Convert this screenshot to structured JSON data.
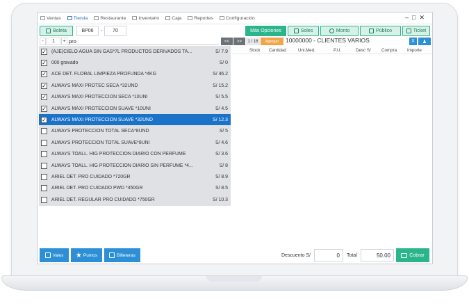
{
  "menu": {
    "items": [
      {
        "label": "Ventas",
        "icon": "chart-icon",
        "active": false
      },
      {
        "label": "Tienda",
        "icon": "store-icon",
        "active": true
      },
      {
        "label": "Restaurante",
        "icon": "cutlery-icon",
        "active": false
      },
      {
        "label": "Inventario",
        "icon": "inventory-icon",
        "active": false
      },
      {
        "label": "Caja",
        "icon": "cash-icon",
        "active": false
      },
      {
        "label": "Reportes",
        "icon": "report-icon",
        "active": false
      },
      {
        "label": "Configuración",
        "icon": "gear-icon",
        "active": false
      }
    ],
    "window_controls": "–□✕"
  },
  "toolbar": {
    "boleta": "Boleta",
    "series": "BP06",
    "dash": "-",
    "number": "70",
    "mas_opciones": "Más Opciones",
    "soles": "Soles",
    "monto": "Monto",
    "publico": "Público",
    "ticket": "Ticket"
  },
  "nav": {
    "minus": "-",
    "page": "1",
    "plus": "+",
    "search_value": "pro",
    "prev": "<<",
    "next": ">>",
    "page_count": "1 / 16",
    "agregar": "Agregar",
    "client": "10000000 - CLIENTES VARIOS",
    "clear": "X"
  },
  "products": [
    {
      "name": "(AJE)CIELO AGUA SIN GAS*7L PRODUCTOS DERIVADOS TA...",
      "price": "S/ 7.9",
      "checked": true,
      "selected": false
    },
    {
      "name": "000 gravado",
      "price": "S/ 0",
      "checked": true,
      "selected": false
    },
    {
      "name": "ACE DET. FLORAL LIMPIEZA PROFUNDA *4KG",
      "price": "S/ 46.2",
      "checked": true,
      "selected": false
    },
    {
      "name": "ALWAYS MAXI PROTEC SECA *32UND",
      "price": "S/ 15.2",
      "checked": true,
      "selected": false
    },
    {
      "name": "ALWAYS MAXI PROTECCION SECA *10UNI",
      "price": "S/ 5.5",
      "checked": true,
      "selected": false
    },
    {
      "name": "ALWAYS MAXI PROTECCION SUAVE *10UNI",
      "price": "S/ 4.5",
      "checked": true,
      "selected": false
    },
    {
      "name": "ALWAYS MAXI PROTECCION SUAVE *32UND",
      "price": "S/ 12.3",
      "checked": true,
      "selected": true
    },
    {
      "name": "ALWAYS PROTECCION TOTAL SECA*8UND",
      "price": "S/ 5",
      "checked": false,
      "selected": false
    },
    {
      "name": "ALWAYS PROTECCION TOTAL SUAVE*8UNI",
      "price": "S/ 4.6",
      "checked": false,
      "selected": false
    },
    {
      "name": "ALWAYS TOALL. HIG PROTECCION DIARIO CON PERFUME",
      "price": "S/ 3.6",
      "checked": false,
      "selected": false
    },
    {
      "name": "ALWAYS TOALL. HIG PROTECCION DIARIO SIN PERFUME *4...",
      "price": "S/ 8",
      "checked": false,
      "selected": false
    },
    {
      "name": "ARIEL DET. PRO CUIDADO *720GR",
      "price": "S/ 8.9",
      "checked": false,
      "selected": false
    },
    {
      "name": "ARIEL DET. PRO CUIDADO PWD *450GR",
      "price": "S/ 8.5",
      "checked": false,
      "selected": false
    },
    {
      "name": "ARIEL DET. REGULAR PRO CUIDADO *750GR",
      "price": "S/ 10.3",
      "checked": false,
      "selected": false
    }
  ],
  "detail_columns": [
    "Stock",
    "Cantidad",
    "Uni.Med.",
    "P.U.",
    "Desc S/",
    "Compra",
    "Importe"
  ],
  "footer": {
    "vales": "Vales",
    "puntos": "Puntos",
    "billeteras": "Billeteras",
    "descuento_label": "Descuento S/",
    "descuento_value": "0",
    "total_label": "Total",
    "total_value": "50.00",
    "cobrar": "Cobrar"
  },
  "colors": {
    "accent_green": "#2bb58a",
    "accent_blue": "#2d8fd5",
    "selected_row": "#1a73c9",
    "orange": "#f0a64a"
  }
}
